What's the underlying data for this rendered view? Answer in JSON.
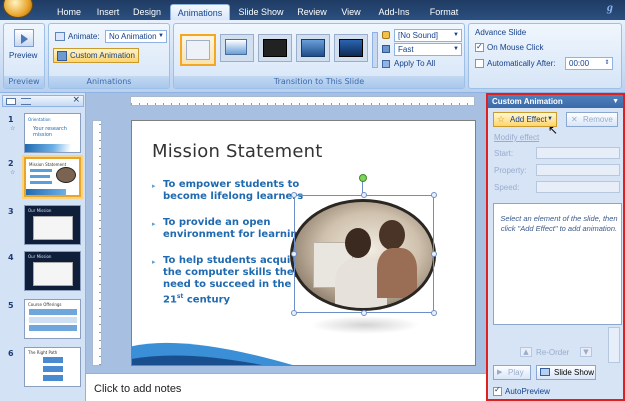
{
  "ribbon_tabs": [
    "Home",
    "Insert",
    "Design",
    "Animations",
    "Slide Show",
    "Review",
    "View",
    "Add-Ins",
    "Format"
  ],
  "active_tab": "Animations",
  "preview_group": {
    "button_label": "Preview",
    "group_label": "Preview"
  },
  "animations_group": {
    "animate_label": "Animate:",
    "animate_value": "No Animation",
    "custom_animation_label": "Custom Animation",
    "group_label": "Animations"
  },
  "transition_group": {
    "sound_value": "[No Sound]",
    "speed_value": "Fast",
    "apply_all_label": "Apply To All",
    "group_label": "Transition to This Slide"
  },
  "advance_group": {
    "title": "Advance Slide",
    "on_mouse_click_label": "On Mouse Click",
    "automatically_after_label": "Automatically After:",
    "time_value": "00:00"
  },
  "slides": [
    {
      "num": "1",
      "title": "Orientation",
      "subtitle": "Your research mission"
    },
    {
      "num": "2",
      "title": "Mission Statement"
    },
    {
      "num": "3",
      "title": "Our Mission"
    },
    {
      "num": "4",
      "title": "Our Mission"
    },
    {
      "num": "5",
      "title": "Course Offerings"
    },
    {
      "num": "6",
      "title": "The Right Path"
    }
  ],
  "slide": {
    "title": "Mission Statement",
    "bullets": [
      "To empower students to become lifelong learners",
      "To provide an open environment for learning",
      "To help students acquire the computer skills they need to succeed in the 21"
    ],
    "ordinal_suffix": "st",
    "trailing_word": " century"
  },
  "notes_placeholder": "Click to add notes",
  "task_pane": {
    "title": "Custom Animation",
    "add_effect_label": "Add Effect",
    "remove_label": "Remove",
    "modify_effect_label": "Modify effect",
    "start_label": "Start:",
    "property_label": "Property:",
    "speed_label": "Speed:",
    "hint_text": "Select an element of the slide, then click \"Add Effect\" to add animation.",
    "reorder_label": "Re-Order",
    "play_label": "Play",
    "slideshow_label": "Slide Show",
    "autopreview_label": "AutoPreview",
    "autopreview_checked": true
  },
  "colors": {
    "accent": "#e0201e",
    "ribbon_dark": "#1f3b63",
    "bullet_text": "#1f6ab0"
  }
}
